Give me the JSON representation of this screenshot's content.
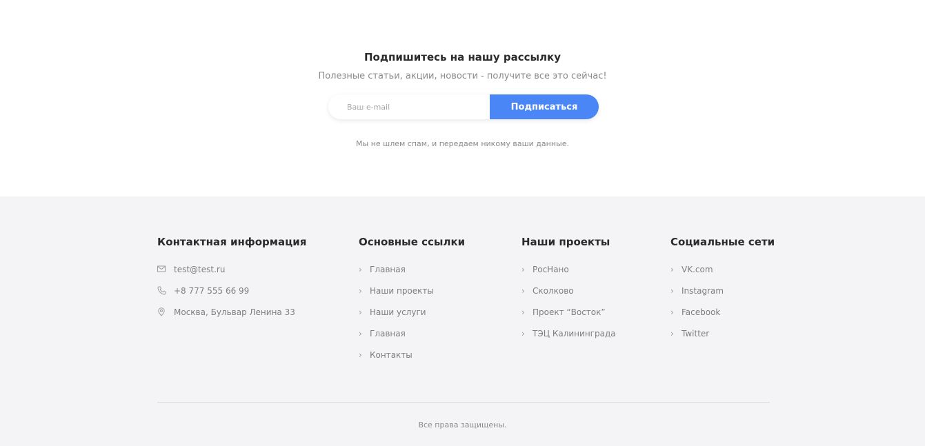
{
  "newsletter": {
    "title": "Подпишитесь на нашу рассылку",
    "subtitle": "Полезные статьи, акции, новости - получите все это сейчас!",
    "email_placeholder": "Ваш e-mail",
    "subscribe_label": "Подписаться",
    "note": "Мы не шлем спам, и передаем никому ваши данные."
  },
  "footer": {
    "contacts": {
      "title": "Контактная информация",
      "email": "test@test.ru",
      "phone": "+8 777 555 66 99",
      "address": "Москва, Бульвар Ленина 33"
    },
    "links": {
      "title": "Основные ссылки",
      "items": [
        "Главная",
        "Наши проекты",
        "Наши услуги",
        "Главная",
        "Контакты"
      ]
    },
    "projects": {
      "title": "Наши проекты",
      "items": [
        "РосНано",
        "Сколково",
        "Проект “Восток”",
        "ТЭЦ Калининграда"
      ]
    },
    "social": {
      "title": "Социальные сети",
      "items": [
        "VK.com",
        "Instagram",
        "Facebook",
        "Twitter"
      ]
    },
    "copyright": "Все права защищены."
  },
  "colors": {
    "accent": "#4a86f5",
    "footer_bg": "#f4f4f6"
  }
}
